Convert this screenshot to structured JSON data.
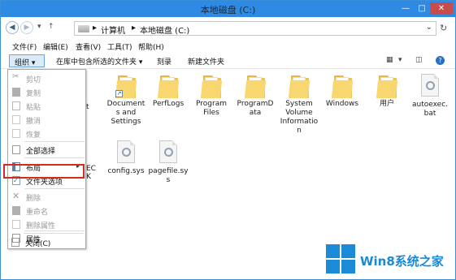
{
  "window": {
    "title": "本地磁盘 (C:)",
    "controls": {
      "minimize": "—",
      "maximize": "□",
      "close": "✕"
    }
  },
  "address": {
    "crumbs": [
      "计算机",
      "本地磁盘 (C:)"
    ],
    "separator": "▸",
    "dropdown": "⌄",
    "refresh": "↻"
  },
  "menubar": [
    "文件(F)",
    "编辑(E)",
    "查看(V)",
    "工具(T)",
    "帮助(H)"
  ],
  "toolbar": {
    "organize": "组织 ▾",
    "include_library": "在库中包含所选的文件夹 ▾",
    "burn": "刻录",
    "new_folder": "新建文件夹"
  },
  "organize_menu": [
    {
      "label": "剪切",
      "icon": "cut-icon",
      "enabled": false
    },
    {
      "label": "复制",
      "icon": "copy-icon",
      "enabled": false
    },
    {
      "label": "粘贴",
      "icon": "paste-icon",
      "enabled": false
    },
    {
      "label": "撤消",
      "icon": "undo-icon",
      "enabled": false
    },
    {
      "label": "恢复",
      "icon": "redo-icon",
      "enabled": false
    },
    {
      "label": "全部选择",
      "icon": "select-all-icon",
      "enabled": true
    },
    {
      "label": "布局",
      "icon": "layout-icon",
      "enabled": true,
      "submenu_arrow": "▸"
    },
    {
      "label": "文件夹选项",
      "icon": "folder-options-icon",
      "enabled": true,
      "highlighted": true
    },
    {
      "label": "删除",
      "icon": "delete-icon",
      "enabled": false
    },
    {
      "label": "重命名",
      "icon": "rename-icon",
      "enabled": false
    },
    {
      "label": "删除属性",
      "icon": "remove-properties-icon",
      "enabled": false
    },
    {
      "label": "属性",
      "icon": "properties-icon",
      "enabled": true
    },
    {
      "label": "关闭(C)",
      "icon": "close-window-icon",
      "enabled": true
    }
  ],
  "items": [
    {
      "name": "Documents and Settings",
      "type": "folder-shortcut",
      "lines": [
        "Document",
        "s and",
        "Settings"
      ]
    },
    {
      "name": "PerfLogs",
      "type": "folder",
      "lines": [
        "PerfLogs"
      ]
    },
    {
      "name": "Program Files",
      "type": "folder",
      "lines": [
        "Program",
        "Files"
      ]
    },
    {
      "name": "ProgramData",
      "type": "folder",
      "lines": [
        "ProgramD",
        "ata"
      ]
    },
    {
      "name": "System Volume Information",
      "type": "folder",
      "lines": [
        "System",
        "Volume",
        "Informatio",
        "n"
      ]
    },
    {
      "name": "Windows",
      "type": "folder",
      "lines": [
        "Windows"
      ]
    },
    {
      "name": "用户",
      "type": "folder",
      "lines": [
        "用户"
      ]
    },
    {
      "name": "autoexec.bat",
      "type": "file",
      "lines": [
        "autoexec.",
        "bat"
      ]
    },
    {
      "name": "config.sys",
      "type": "file",
      "lines": [
        "config.sys"
      ]
    },
    {
      "name": "pagefile.sys",
      "type": "file",
      "lines": [
        "pagefile.sy",
        "s"
      ]
    }
  ],
  "partial_labels": {
    "t": "t",
    "ec": "EC",
    "k": "K"
  },
  "watermark": {
    "text": "Win8系统之家"
  }
}
